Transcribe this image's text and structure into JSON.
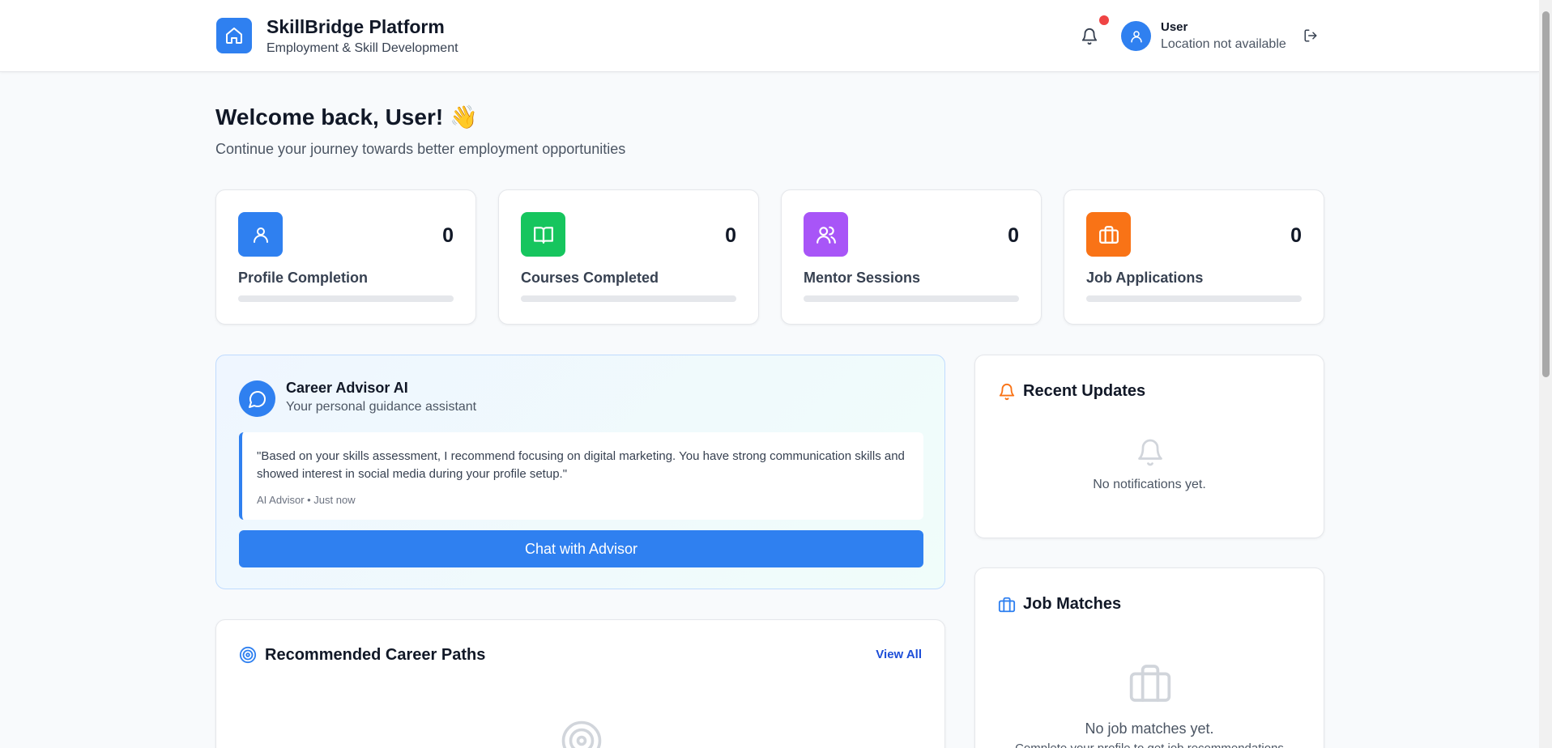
{
  "header": {
    "title": "SkillBridge Platform",
    "subtitle": "Employment & Skill Development",
    "user_name": "User",
    "user_location": "Location not available",
    "icons": {
      "logo": "home-icon",
      "notifications": "bell-icon",
      "avatar": "user-icon",
      "logout": "logout-icon"
    }
  },
  "welcome": {
    "title": "Welcome back, User! 👋",
    "subtitle": "Continue your journey towards better employment opportunities"
  },
  "stats": [
    {
      "label": "Profile Completion",
      "value": "0",
      "progress": 0,
      "color": "#2f80f0",
      "icon": "user-icon"
    },
    {
      "label": "Courses Completed",
      "value": "0",
      "progress": 0,
      "color": "#16c55e",
      "icon": "book-open-icon"
    },
    {
      "label": "Mentor Sessions",
      "value": "0",
      "progress": 0,
      "color": "#a855f7",
      "icon": "users-icon"
    },
    {
      "label": "Job Applications",
      "value": "0",
      "progress": 0,
      "color": "#f97316",
      "icon": "briefcase-icon"
    }
  ],
  "advisor": {
    "title": "Career Advisor AI",
    "subtitle": "Your personal guidance assistant",
    "quote": "\"Based on your skills assessment, I recommend focusing on digital marketing. You have strong communication skills and showed interest in social media during your profile setup.\"",
    "meta": "AI Advisor • Just now",
    "button": "Chat with Advisor",
    "icon": "chat-bubble-icon"
  },
  "career": {
    "title": "Recommended Career Paths",
    "view_all": "View All",
    "icon": "target-icon"
  },
  "updates": {
    "title": "Recent Updates",
    "empty": "No notifications yet.",
    "icon": "bell-icon"
  },
  "jobs": {
    "title": "Job Matches",
    "empty": "No job matches yet.",
    "empty_sub": "Complete your profile to get job recommendations",
    "icon": "briefcase-icon"
  },
  "colors": {
    "primary": "#2f80f0",
    "notification_dot": "#ef4444",
    "updates_accent": "#f97316"
  }
}
